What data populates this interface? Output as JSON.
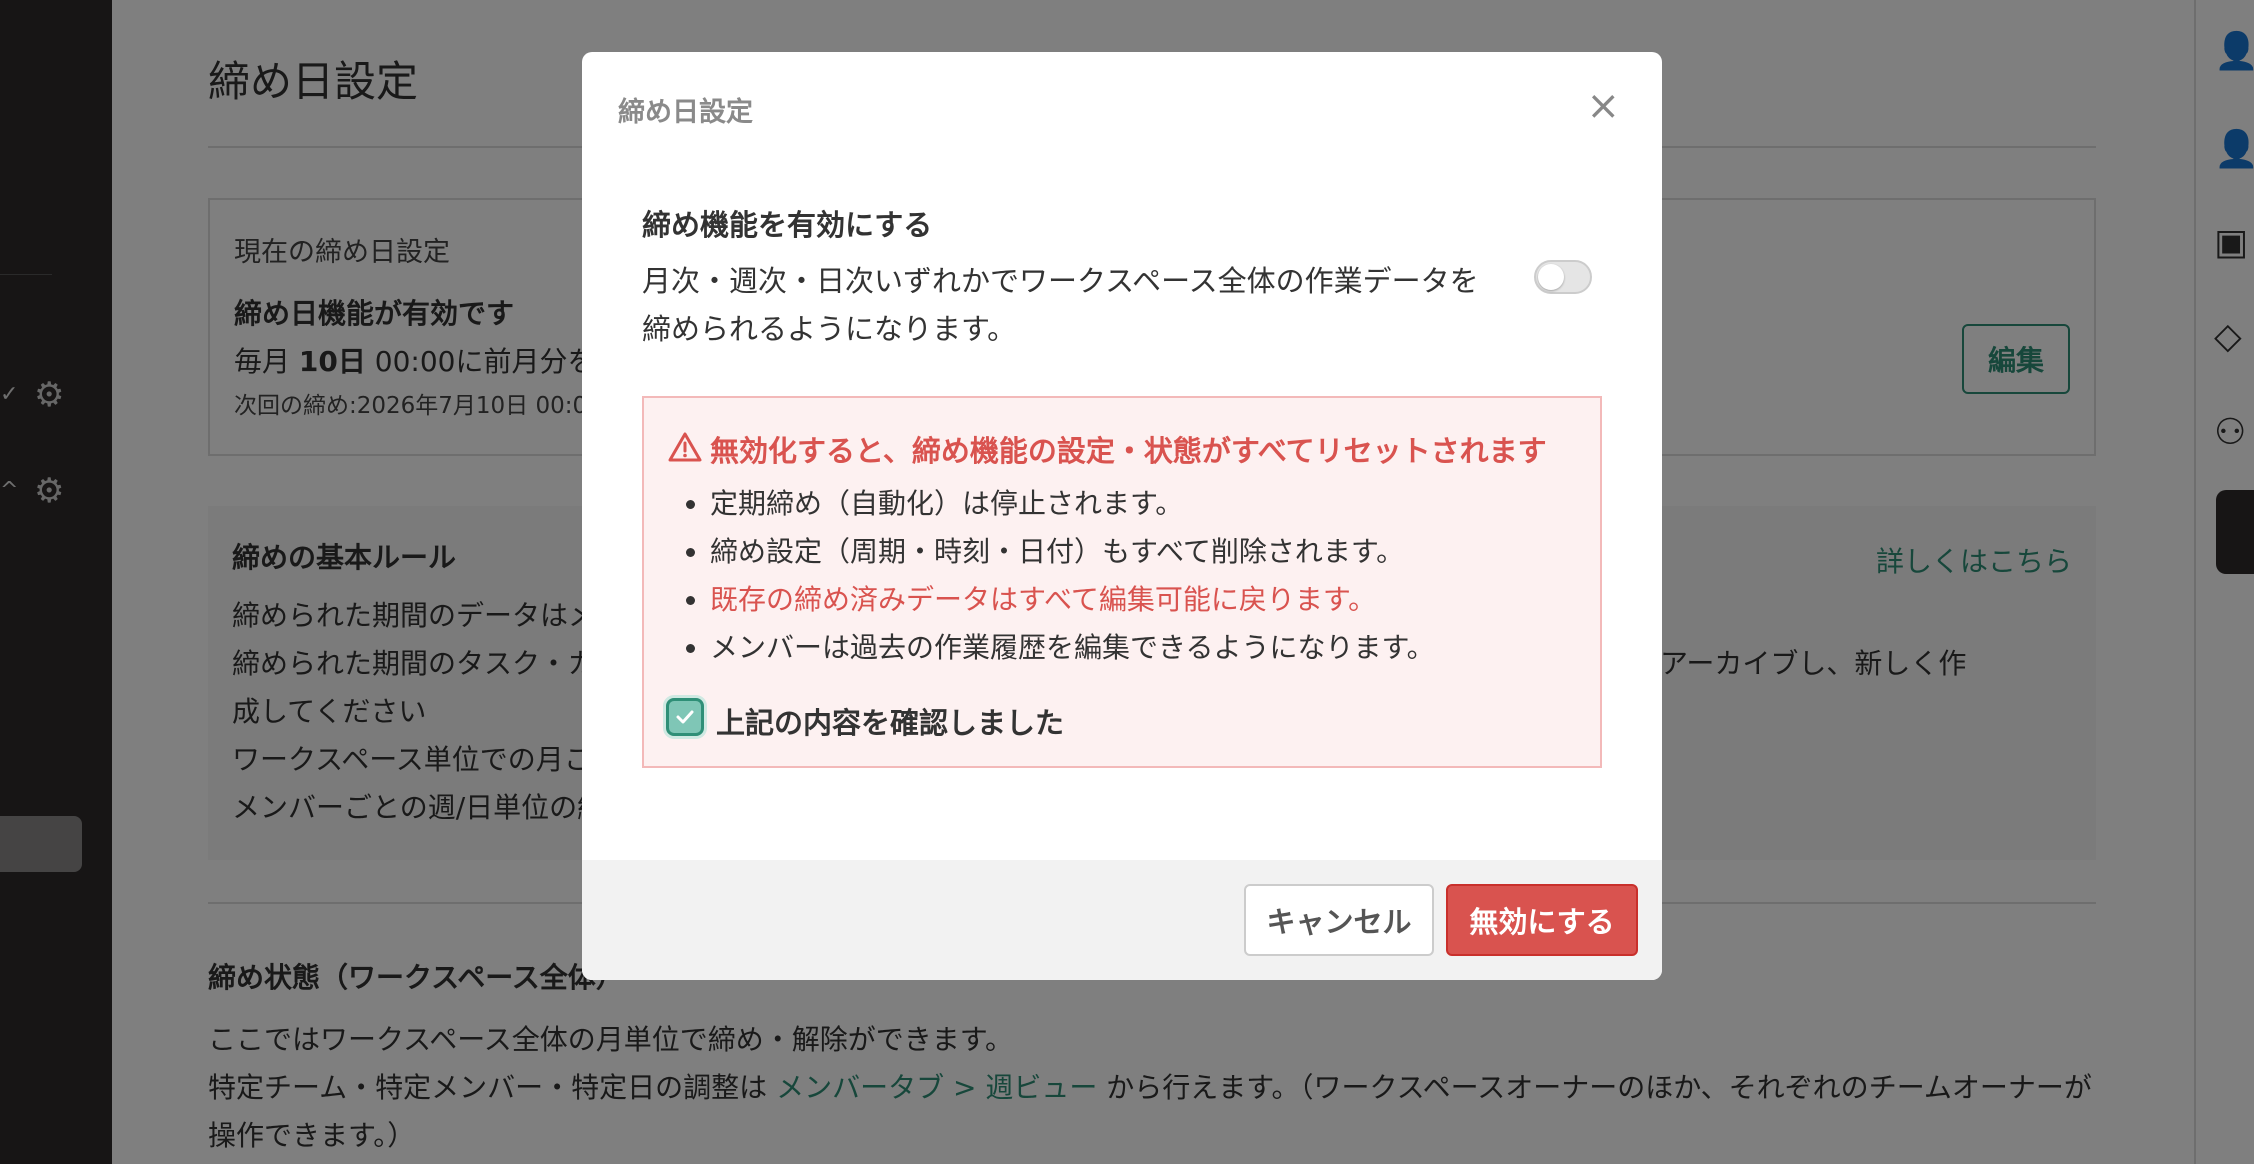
{
  "main": {
    "page_title": "締め日設定",
    "current_card": {
      "label": "現在の締め日設定",
      "status": "締め日機能が有効です",
      "schedule_prefix": "毎月 ",
      "schedule_day": "10日",
      "schedule_suffix": " 00:00に前月分を",
      "next": "次回の締め:2026年7月10日 00:0",
      "edit_label": "編集"
    },
    "rules": {
      "title": "締めの基本ルール",
      "link": "詳しくはこちら",
      "lines": [
        "締められた期間のデータはメ",
        "締められた期間のタスク・カ",
        "成してください",
        "ワークスペース単位での月こ",
        "メンバーごとの週/日単位の締"
      ],
      "line2_tail": "い場合はアーカイブし、新しく作"
    },
    "status_section": {
      "title": "締め状態（ワークスペース全体）",
      "line1": "ここではワークスペース全体の月単位で締め・解除ができます。",
      "line2_prefix": "特定チーム・特定メンバー・特定日の調整は ",
      "line2_link": "メンバータブ > 週ビュー",
      "line2_suffix": " から行えます。（ワークスペースオーナーのほか、それぞれのチームオーナーが",
      "line3": "操作できます。）"
    }
  },
  "modal": {
    "title": "締め日設定",
    "close_glyph": "×",
    "enable_title": "締め機能を有効にする",
    "enable_desc": "月次・週次・日次いずれかでワークスペース全体の作業データを締められるようになります。",
    "toggle_on": false,
    "warning": {
      "title": "無効化すると、締め機能の設定・状態がすべてリセットされます",
      "items": [
        "定期締め（自動化）は停止されます。",
        "締め設定（周期・時刻・日付）もすべて削除されます。",
        "既存の締め済みデータはすべて編集可能に戻ります。",
        "メンバーは過去の作業履歴を編集できるようになります。"
      ],
      "confirm_label": "上記の内容を確認しました",
      "confirm_checked": true
    },
    "cancel_label": "キャンセル",
    "disable_label": "無効にする"
  },
  "colors": {
    "accent": "#2f8f77",
    "danger": "#d9534f",
    "overlay": "rgba(0,0,0,0.5)"
  }
}
